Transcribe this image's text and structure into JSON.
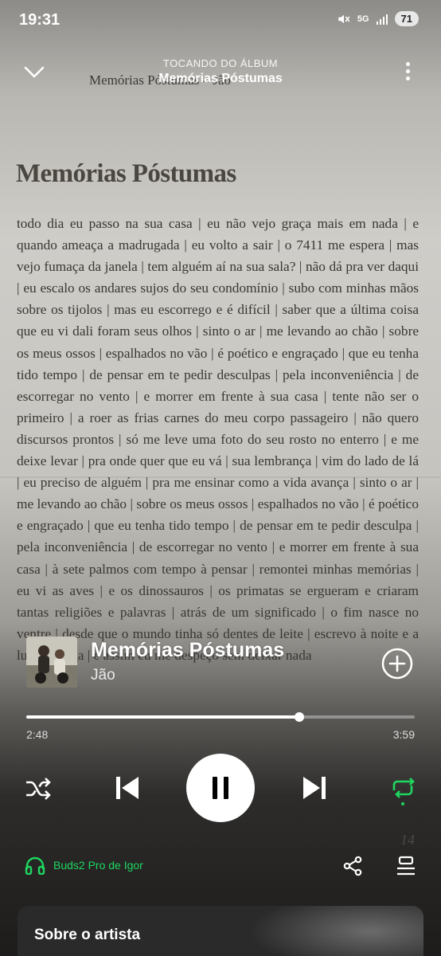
{
  "status_bar": {
    "time": "19:31",
    "battery": "71",
    "network": "5G"
  },
  "header": {
    "context_label": "TOCANDO DO ÁLBUM",
    "album": "Memórias Póstumas"
  },
  "background_page": {
    "header_line": "Memórias Póstumas  –  Jão",
    "title": "Memórias Póstumas",
    "lyrics": "todo dia eu passo na sua casa | eu não vejo graça mais em nada | e quando ameaça a madrugada | eu volto a sair | o 7411 me espera | mas vejo fumaça da janela | tem alguém aí na sua sala? | não dá pra ver daqui | eu escalo os andares sujos do seu condomínio | subo com minhas mãos sobre os tijolos | mas eu escorrego e é difícil | saber que a última coisa que eu vi dali foram seus olhos | sinto o ar | me levando ao chão | sobre os meus ossos | espalhados no vão | é poético e engraçado | que eu tenha tido tempo | de pensar em te pedir desculpas | pela inconveniência | de escorregar no vento | e morrer em frente à sua casa | tente não ser o primeiro | a roer as frias carnes do meu corpo passageiro | não quero discursos prontos | só me leve uma foto do seu rosto no enterro | e me deixe levar | pra onde quer que eu vá | sua lembrança | vim do lado de lá | eu preciso de alguém | pra me ensinar como a vida avança | sinto o ar | me levando ao chão | sobre os meus ossos | espalhados no vão | é poético e engraçado | que eu tenha tido tempo | de pensar em te pedir desculpa | pela inconveniência | de escorregar no vento | e morrer em frente à sua casa | à sete palmos com tempo à pensar | remontei minhas memórias | eu vi as aves | e os dinossauros | os primatas se ergueram e criaram tantas religiões e palavras | atrás de um significado | o fim nasce no ventre | desde que o mundo tinha só dentes de leite | escrevo à noite e a luz se apaga | e assim eu me despeço sem deixar nada",
    "page_number": "14"
  },
  "track": {
    "title": "Memórias Póstumas",
    "artist": "Jão"
  },
  "playback": {
    "current_time": "2:48",
    "total_time": "3:59",
    "progress": 0.702
  },
  "controls": {
    "shuffle_icon": "shuffle-icon",
    "previous_icon": "skip-previous-icon",
    "play_pause_icon": "pause-icon",
    "next_icon": "skip-next-icon",
    "repeat_icon": "repeat-icon"
  },
  "device": {
    "label": "Buds2 Pro de Igor",
    "icon": "headphones-icon"
  },
  "about_artist": {
    "title": "Sobre o artista"
  },
  "colors": {
    "accent": "#1ed760",
    "text": "#ffffff"
  }
}
